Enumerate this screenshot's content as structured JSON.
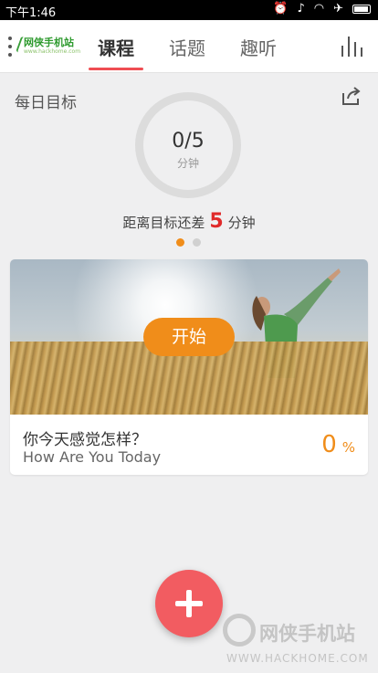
{
  "status_bar": {
    "time": "下午1:46",
    "icons": [
      "alarm-icon",
      "mute-icon",
      "wifi-icon",
      "airplane-icon",
      "battery-icon"
    ]
  },
  "header": {
    "logo_text": "网侠手机站",
    "logo_sub": "www.hackhome.com",
    "tabs": [
      {
        "label": "课程"
      },
      {
        "label": "话题"
      },
      {
        "label": "趣听"
      }
    ],
    "active_tab_color": "#ef4d53"
  },
  "goal": {
    "label": "每日目标",
    "progress_value": "0/5",
    "progress_unit": "分钟",
    "remaining_prefix": "距离目标还差",
    "remaining_number": "5",
    "remaining_suffix": "分钟",
    "page_dots": {
      "count": 2,
      "active": 0
    }
  },
  "card": {
    "start_label": "开始",
    "title": "你今天感觉怎样？",
    "subtitle": "How Are You Today",
    "percent_value": "0",
    "percent_unit": "%"
  },
  "watermark": {
    "name": "网侠手机站",
    "url": "WWW.HACKHOME.COM"
  },
  "colors": {
    "accent": "#f08d1a",
    "fab": "#f25c61",
    "remaining_number": "#e02a2a"
  }
}
